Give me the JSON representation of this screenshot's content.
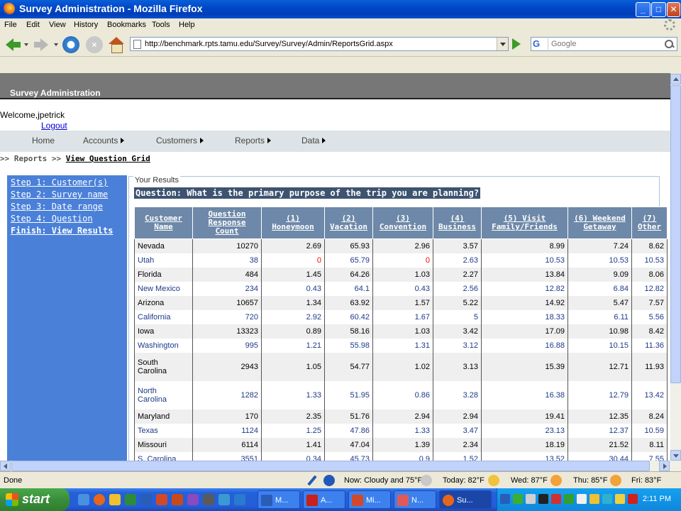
{
  "window": {
    "title": "Survey Administration - Mozilla Firefox"
  },
  "menu": [
    "File",
    "Edit",
    "View",
    "History",
    "Bookmarks",
    "Tools",
    "Help"
  ],
  "toolbar": {
    "url": "http://benchmark.rpts.tamu.edu/Survey/Survey/Admin/ReportsGrid.aspx",
    "search_placeholder": "Google",
    "stop_label": "×"
  },
  "page": {
    "header": "Survey Administration",
    "welcome": "Welcome,jpetrick",
    "logout": "Logout",
    "nav": [
      "Home",
      "Accounts",
      "Customers",
      "Reports",
      "Data"
    ],
    "breadcrumb": {
      "prefix": ">> Reports >> ",
      "current": "View Question Grid"
    },
    "steps": [
      "Step 1: Customer(s)",
      "Step 2: Survey name",
      "Step 3: Date range",
      "Step 4: Question",
      "Finish: View Results"
    ],
    "results_legend": "Your Results",
    "question": "Question: What is the primary purpose of the trip you are planning?"
  },
  "grid": {
    "columns": [
      [
        "Customer",
        "Name"
      ],
      [
        "Question",
        "Response",
        "Count"
      ],
      [
        "(1)",
        "Honeymoon"
      ],
      [
        "(2)",
        "Vacation"
      ],
      [
        "(3)",
        "Convention"
      ],
      [
        "(4)",
        "Business"
      ],
      [
        "(5) Visit",
        "Family/Friends"
      ],
      [
        "(6) Weekend",
        "Getaway"
      ],
      [
        "(7)",
        "Other"
      ]
    ],
    "rows": [
      {
        "name": [
          "Nevada"
        ],
        "values": [
          "10270",
          "2.69",
          "65.93",
          "2.96",
          "3.57",
          "8.99",
          "7.24",
          "8.62"
        ]
      },
      {
        "name": [
          "Utah"
        ],
        "values": [
          "38",
          "0",
          "65.79",
          "0",
          "2.63",
          "10.53",
          "10.53",
          "10.53"
        ],
        "red": [
          1,
          3
        ]
      },
      {
        "name": [
          "Florida"
        ],
        "values": [
          "484",
          "1.45",
          "64.26",
          "1.03",
          "2.27",
          "13.84",
          "9.09",
          "8.06"
        ]
      },
      {
        "name": [
          "New Mexico"
        ],
        "values": [
          "234",
          "0.43",
          "64.1",
          "0.43",
          "2.56",
          "12.82",
          "6.84",
          "12.82"
        ]
      },
      {
        "name": [
          "Arizona"
        ],
        "values": [
          "10657",
          "1.34",
          "63.92",
          "1.57",
          "5.22",
          "14.92",
          "5.47",
          "7.57"
        ]
      },
      {
        "name": [
          "California"
        ],
        "values": [
          "720",
          "2.92",
          "60.42",
          "1.67",
          "5",
          "18.33",
          "6.11",
          "5.56"
        ]
      },
      {
        "name": [
          "Iowa"
        ],
        "values": [
          "13323",
          "0.89",
          "58.16",
          "1.03",
          "3.42",
          "17.09",
          "10.98",
          "8.42"
        ]
      },
      {
        "name": [
          "Washington"
        ],
        "values": [
          "995",
          "1.21",
          "55.98",
          "1.31",
          "3.12",
          "16.88",
          "10.15",
          "11.36"
        ]
      },
      {
        "name": [
          "South",
          "Carolina"
        ],
        "values": [
          "2943",
          "1.05",
          "54.77",
          "1.02",
          "3.13",
          "15.39",
          "12.71",
          "11.93"
        ]
      },
      {
        "name": [
          "North",
          "Carolina"
        ],
        "values": [
          "1282",
          "1.33",
          "51.95",
          "0.86",
          "3.28",
          "16.38",
          "12.79",
          "13.42"
        ]
      },
      {
        "name": [
          "Maryland"
        ],
        "values": [
          "170",
          "2.35",
          "51.76",
          "2.94",
          "2.94",
          "19.41",
          "12.35",
          "8.24"
        ]
      },
      {
        "name": [
          "Texas"
        ],
        "values": [
          "1124",
          "1.25",
          "47.86",
          "1.33",
          "3.47",
          "23.13",
          "12.37",
          "10.59"
        ]
      },
      {
        "name": [
          "Missouri"
        ],
        "values": [
          "6114",
          "1.41",
          "47.04",
          "1.39",
          "2.34",
          "18.19",
          "21.52",
          "8.11"
        ]
      },
      {
        "name": [
          "S. Carolina"
        ],
        "values": [
          "3551",
          "0.34",
          "45.73",
          "0.9",
          "1.52",
          "13.52",
          "30.44",
          "7.55"
        ]
      }
    ]
  },
  "status": {
    "text": "Done",
    "weather": [
      "Now: Cloudy and 75°F",
      "Today: 82°F",
      "Wed: 87°F",
      "Thu: 85°F",
      "Fri: 83°F"
    ]
  },
  "taskbar": {
    "start": "start",
    "tasks": [
      "M...",
      "A...",
      "Mi...",
      "N...",
      "Su..."
    ],
    "clock": "2:11 PM"
  },
  "colors": {
    "sidebar": "#4a80d8",
    "grid_header": "#6d88a8",
    "question_bg": "#3d5370",
    "zero_value": "#ff0000"
  }
}
